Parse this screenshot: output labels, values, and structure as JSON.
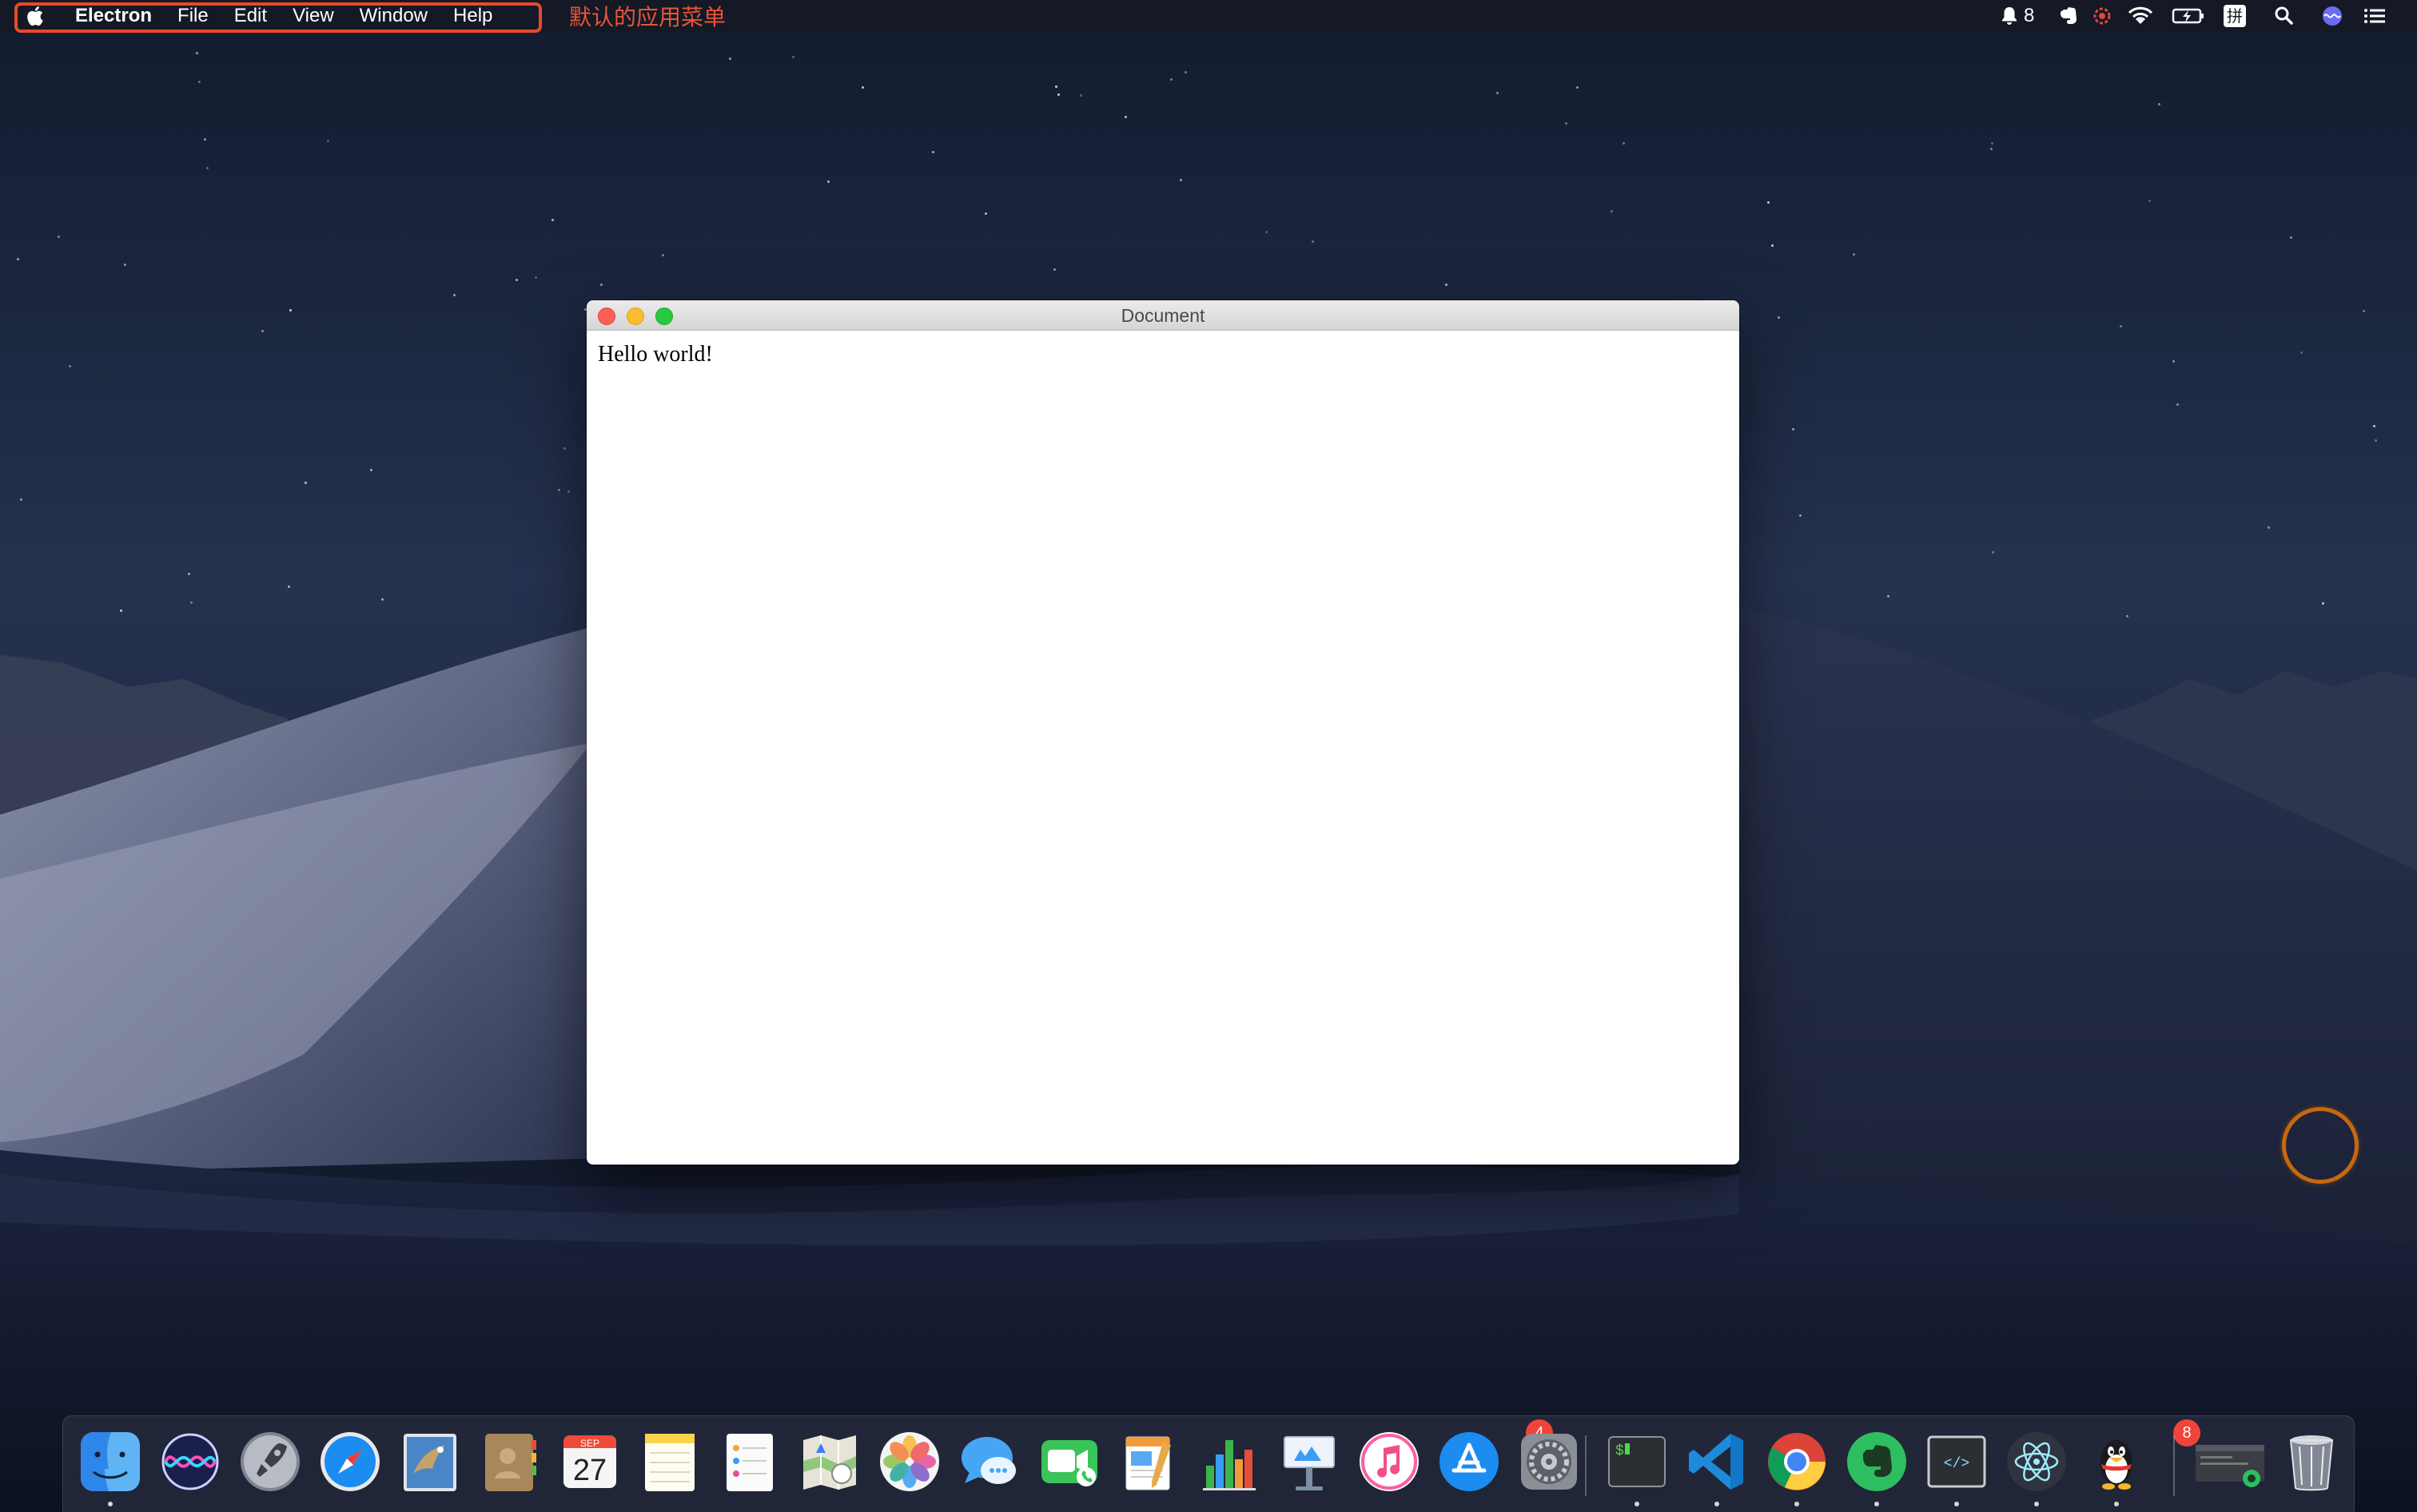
{
  "menubar": {
    "apple_icon": "apple-icon",
    "app_name": "Electron",
    "items": [
      "File",
      "Edit",
      "View",
      "Window",
      "Help"
    ],
    "annotation": "默认的应用菜单",
    "annotation_color": "#e8543a",
    "status": {
      "notifications_count": "8",
      "input_method": "拼"
    }
  },
  "window": {
    "title": "Document",
    "content_text": "Hello world!"
  },
  "dock": {
    "items": [
      {
        "name": "Finder",
        "icon": "finder-icon",
        "running": true
      },
      {
        "name": "Siri",
        "icon": "siri-icon"
      },
      {
        "name": "Launchpad",
        "icon": "launchpad-icon"
      },
      {
        "name": "Safari",
        "icon": "safari-icon"
      },
      {
        "name": "Mail",
        "icon": "mail-icon"
      },
      {
        "name": "Contacts",
        "icon": "contacts-icon"
      },
      {
        "name": "Calendar",
        "icon": "calendar-icon",
        "month": "SEP",
        "day": "27"
      },
      {
        "name": "Notes",
        "icon": "notes-icon"
      },
      {
        "name": "Reminders",
        "icon": "reminders-icon"
      },
      {
        "name": "Maps",
        "icon": "maps-icon"
      },
      {
        "name": "Photos",
        "icon": "photos-icon"
      },
      {
        "name": "Messages",
        "icon": "messages-icon"
      },
      {
        "name": "FaceTime",
        "icon": "facetime-icon"
      },
      {
        "name": "Pages",
        "icon": "pages-icon"
      },
      {
        "name": "Numbers",
        "icon": "numbers-icon"
      },
      {
        "name": "Keynote",
        "icon": "keynote-icon"
      },
      {
        "name": "iTunes",
        "icon": "itunes-icon"
      },
      {
        "name": "App Store",
        "icon": "app-store-icon",
        "badge": "4"
      },
      {
        "name": "System Preferences",
        "icon": "system-preferences-icon"
      },
      {
        "name": "Terminal",
        "icon": "terminal-icon",
        "running": true
      },
      {
        "name": "Visual Studio Code",
        "icon": "vscode-icon",
        "running": true
      },
      {
        "name": "Google Chrome",
        "icon": "chrome-icon",
        "running": true
      },
      {
        "name": "Evernote",
        "icon": "evernote-icon",
        "running": true
      },
      {
        "name": "Script Editor",
        "icon": "script-editor-icon",
        "running": true
      },
      {
        "name": "Electron",
        "icon": "electron-icon",
        "running": true
      },
      {
        "name": "QQ",
        "icon": "qq-icon",
        "badge": "8",
        "running": true
      },
      {
        "name": "Recent Window",
        "icon": "minimized-window-icon"
      },
      {
        "name": "Trash",
        "icon": "trash-icon"
      }
    ]
  }
}
